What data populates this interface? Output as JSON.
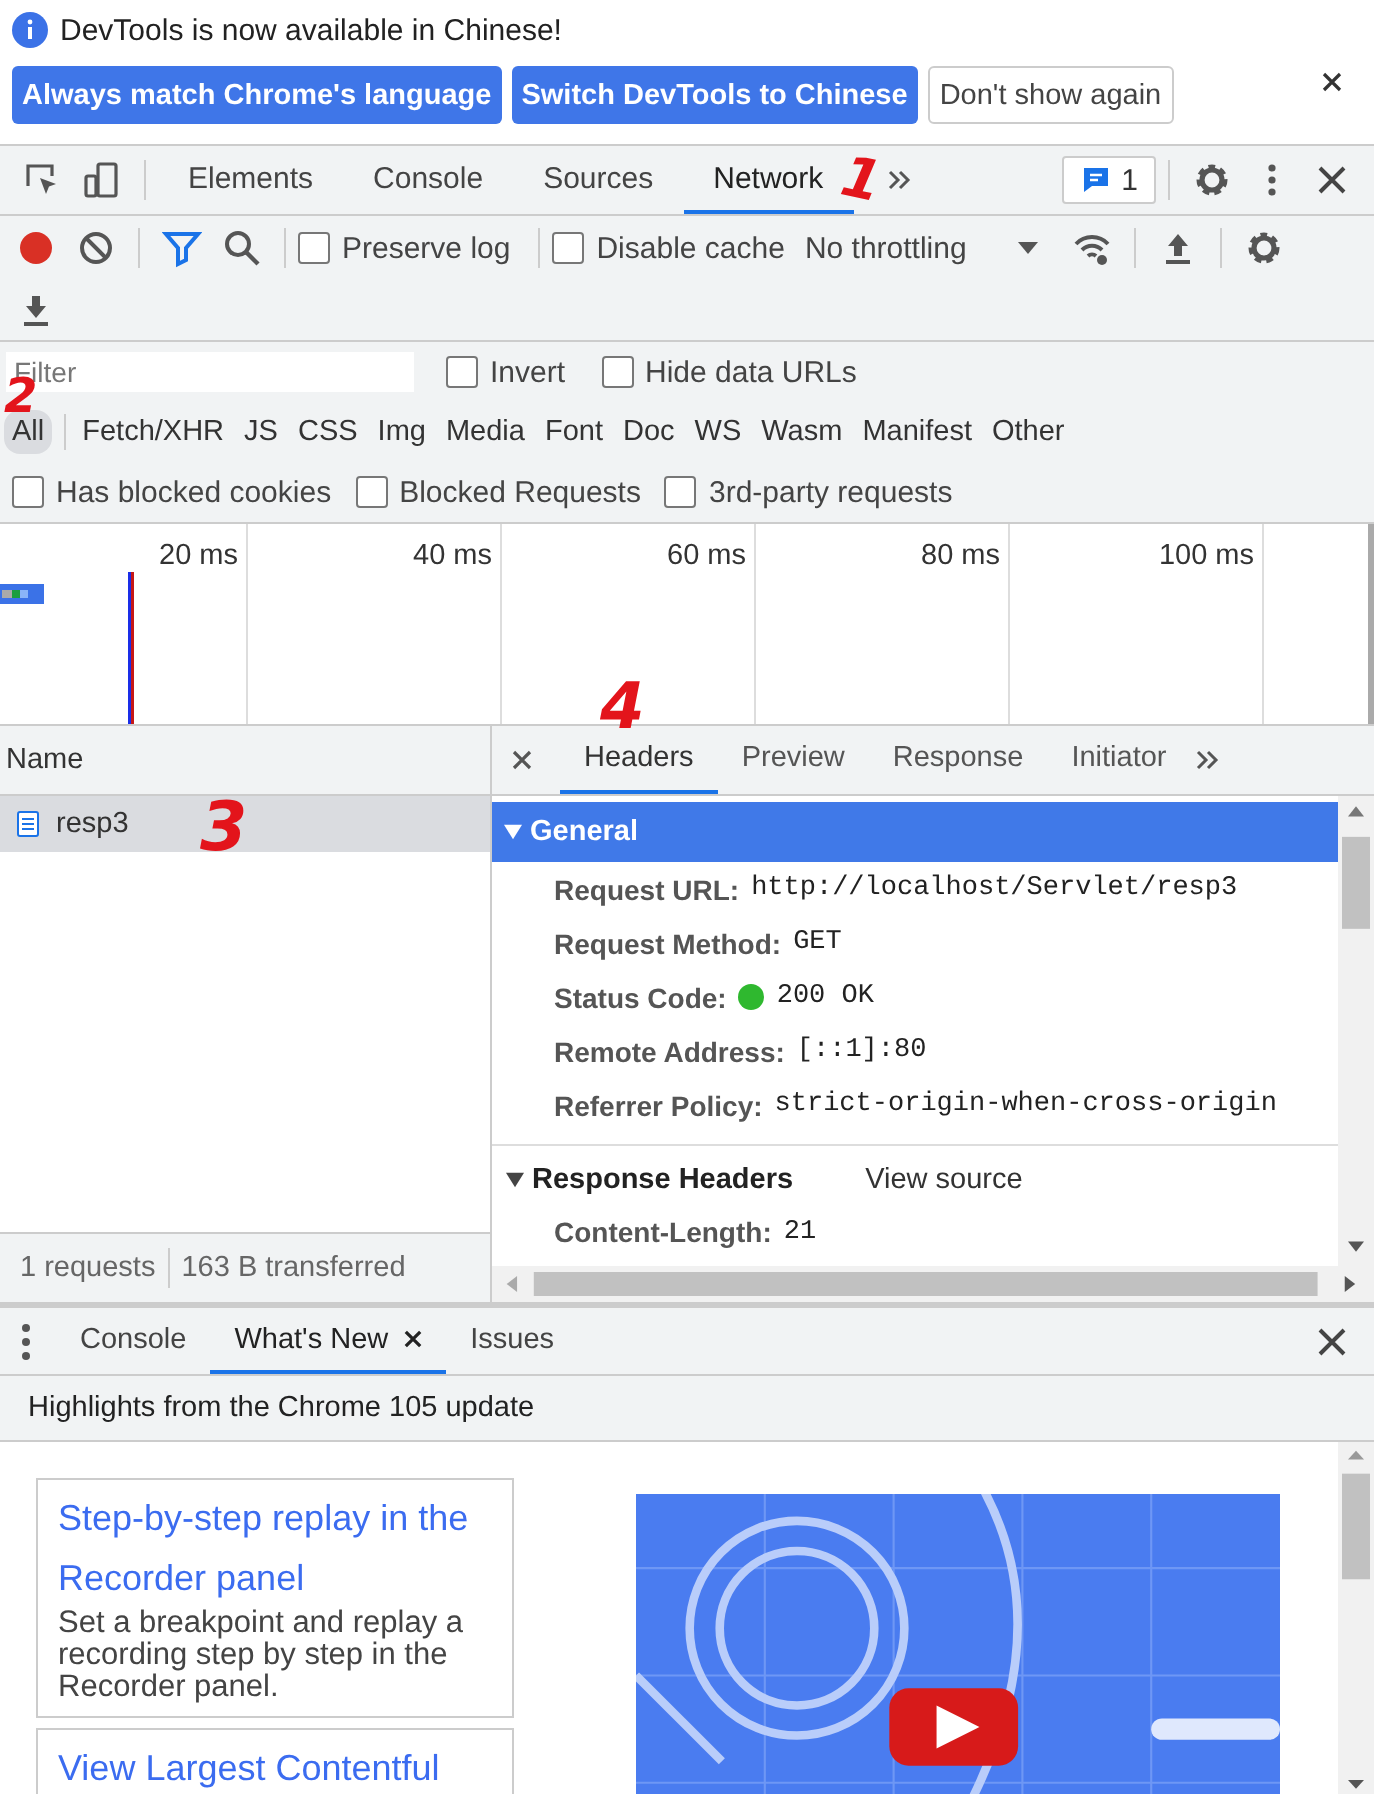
{
  "infobar": {
    "message": "DevTools is now available in Chinese!",
    "buttons": [
      {
        "label": "Always match Chrome's language",
        "kind": "primary"
      },
      {
        "label": "Switch DevTools to Chinese",
        "kind": "primary"
      },
      {
        "label": "Don't show again",
        "kind": "plain"
      }
    ]
  },
  "main_tabs": [
    {
      "label": "Elements",
      "selected": false
    },
    {
      "label": "Console",
      "selected": false
    },
    {
      "label": "Sources",
      "selected": false
    },
    {
      "label": "Network",
      "selected": true,
      "annotation": "1"
    }
  ],
  "issues_badge": "1",
  "network_toolbar": {
    "recording": true,
    "preserve_log": {
      "label": "Preserve log",
      "checked": false
    },
    "disable_cache": {
      "label": "Disable cache",
      "checked": false
    },
    "throttling": "No throttling"
  },
  "filter": {
    "placeholder": "Filter",
    "annotation": "2",
    "invert": {
      "label": "Invert",
      "checked": false
    },
    "hide_data_urls": {
      "label": "Hide data URLs",
      "checked": false
    }
  },
  "type_filters": [
    {
      "label": "All",
      "selected": true
    },
    {
      "label": "Fetch/XHR",
      "selected": false
    },
    {
      "label": "JS",
      "selected": false
    },
    {
      "label": "CSS",
      "selected": false
    },
    {
      "label": "Img",
      "selected": false
    },
    {
      "label": "Media",
      "selected": false
    },
    {
      "label": "Font",
      "selected": false
    },
    {
      "label": "Doc",
      "selected": false
    },
    {
      "label": "WS",
      "selected": false
    },
    {
      "label": "Wasm",
      "selected": false
    },
    {
      "label": "Manifest",
      "selected": false
    },
    {
      "label": "Other",
      "selected": false
    }
  ],
  "extra_filters": [
    {
      "label": "Has blocked cookies",
      "checked": false
    },
    {
      "label": "Blocked Requests",
      "checked": false
    },
    {
      "label": "3rd-party requests",
      "checked": false
    }
  ],
  "timeline_ticks": [
    "20 ms",
    "40 ms",
    "60 ms",
    "80 ms",
    "100 ms"
  ],
  "requests": {
    "column": "Name",
    "rows": [
      {
        "name": "resp3",
        "selected": true,
        "annotation": "3"
      }
    ],
    "status": [
      "1 requests",
      "163 B transferred"
    ]
  },
  "detail_tabs": [
    {
      "label": "Headers",
      "selected": true,
      "annotation": "4"
    },
    {
      "label": "Preview",
      "selected": false
    },
    {
      "label": "Response",
      "selected": false
    },
    {
      "label": "Initiator",
      "selected": false
    }
  ],
  "general": {
    "title": "General",
    "expanded": true,
    "rows": [
      {
        "key": "Request URL:",
        "value": "http://localhost/Servlet/resp3"
      },
      {
        "key": "Request Method:",
        "value": "GET"
      },
      {
        "key": "Status Code:",
        "value": "200 OK",
        "dot": true
      },
      {
        "key": "Remote Address:",
        "value": "[::1]:80"
      },
      {
        "key": "Referrer Policy:",
        "value": "strict-origin-when-cross-origin"
      }
    ]
  },
  "response_headers": {
    "title": "Response Headers",
    "expanded": true,
    "link": "View source",
    "rows": [
      {
        "key": "Content-Length:",
        "value": "21"
      }
    ]
  },
  "drawer_tabs": [
    {
      "label": "Console",
      "selected": false,
      "closable": false
    },
    {
      "label": "What's New",
      "selected": true,
      "closable": true
    },
    {
      "label": "Issues",
      "selected": false,
      "closable": false
    }
  ],
  "whats_new": {
    "header": "Highlights from the Chrome 105 update",
    "cards": [
      {
        "title": "Step-by-step replay in the Recorder panel",
        "text": "Set a breakpoint and replay a recording step by step in the Recorder panel."
      },
      {
        "title": "View Largest Contentful"
      }
    ]
  }
}
